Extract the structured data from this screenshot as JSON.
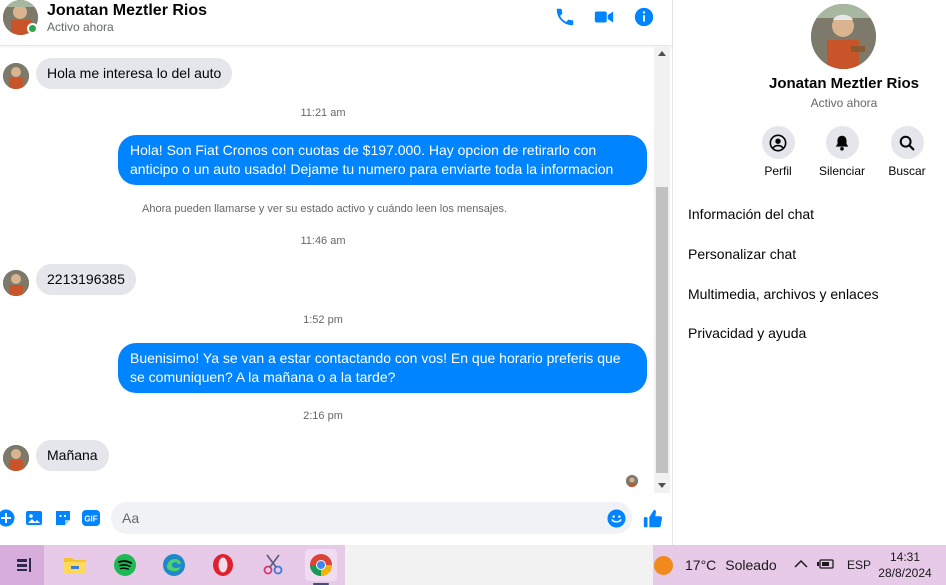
{
  "contact": {
    "name": "Jonatan Meztler Rios",
    "status": "Activo ahora"
  },
  "colors": {
    "accent": "#0084ff",
    "incoming_bubble": "#e4e6eb",
    "online": "#31a24c"
  },
  "header_icons": [
    "phone-icon",
    "video-camera-icon",
    "info-icon"
  ],
  "messages": {
    "m1": "Hola me interesa lo del auto",
    "t1": "11:21 am",
    "m2": "Hola! Son Fiat Cronos con cuotas de $197.000. Hay opcion de retirarlo con anticipo o un auto usado! Dejame tu numero para enviarte toda la informacion",
    "notice": "Ahora pueden llamarse y ver su estado activo y cuándo leen los mensajes.",
    "t2": "11:46 am",
    "m3": "2213196385",
    "t3": "1:52 pm",
    "m4": "Buenisimo! Ya se van a estar contactando con vos! En que horario preferis que se comuniquen? A la mañana o a la tarde?",
    "t4": "2:16 pm",
    "m5": "Mañana"
  },
  "composer": {
    "placeholder": "Aa",
    "gif_label": "GIF",
    "icons": [
      "plus-icon",
      "photo-icon",
      "sticker-icon",
      "gif-icon",
      "emoji-icon",
      "thumbs-up-icon"
    ]
  },
  "info_panel": {
    "actions": [
      {
        "label": "Perfil",
        "icon": "profile-icon"
      },
      {
        "label": "Silenciar",
        "icon": "bell-icon"
      },
      {
        "label": "Buscar",
        "icon": "search-icon"
      }
    ],
    "menu": [
      "Información del chat",
      "Personalizar chat",
      "Multimedia, archivos y enlaces",
      "Privacidad y ayuda"
    ]
  },
  "taskbar": {
    "apps": [
      "task-view-icon",
      "file-explorer-icon",
      "spotify-icon",
      "edge-icon",
      "opera-icon",
      "snipping-tool-icon",
      "chrome-icon"
    ],
    "weather_temp": "17°C",
    "weather_text": "Soleado",
    "language": "ESP",
    "time": "14:31",
    "date": "28/8/2024"
  }
}
